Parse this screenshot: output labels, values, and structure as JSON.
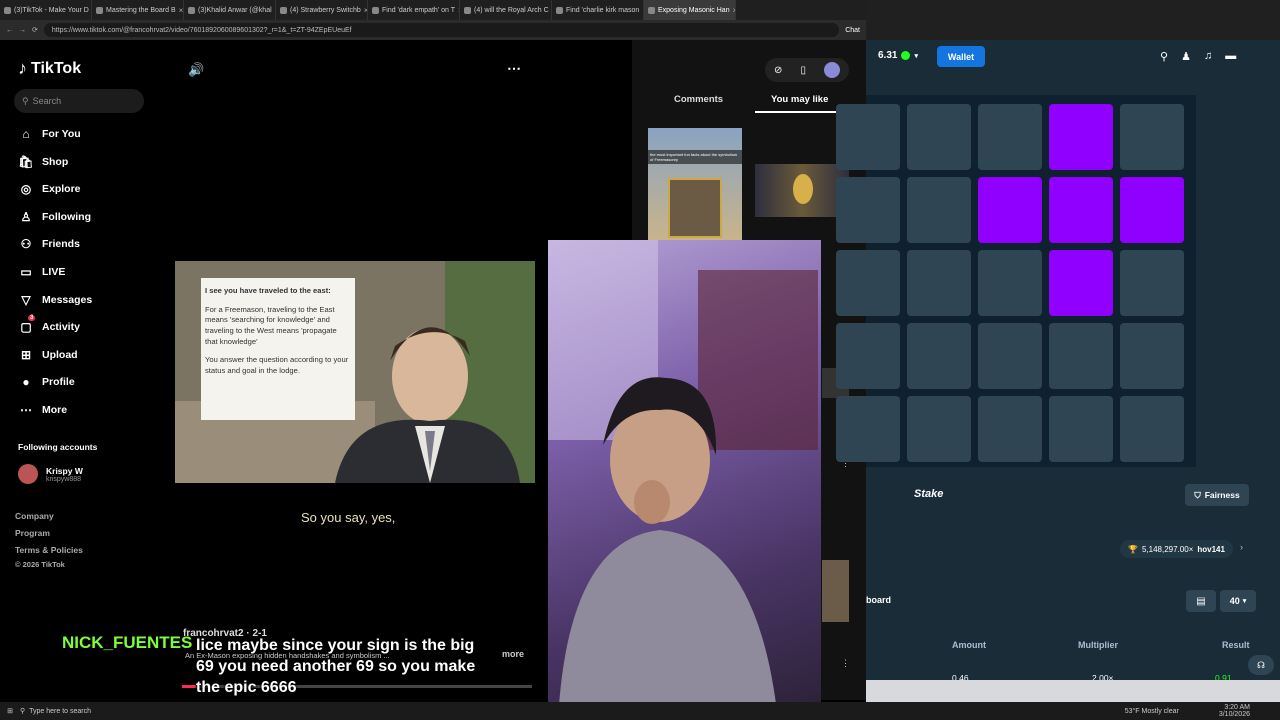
{
  "browser_left": {
    "tabs": [
      {
        "label": "(3)TikTok - Make Your D",
        "active": false
      },
      {
        "label": "Mastering the Board B",
        "active": false
      },
      {
        "label": "(3)Khalid Anwar (@khal",
        "active": false
      },
      {
        "label": "(4) Strawberry Switchb",
        "active": false
      },
      {
        "label": "Find 'dark empath' on T",
        "active": false
      },
      {
        "label": "(4) will the Royal Arch C",
        "active": false
      },
      {
        "label": "Find 'charlie kirk mason",
        "active": false
      },
      {
        "label": "Exposing Masonic Han",
        "active": true
      }
    ],
    "url": "https://www.tiktok.com/@francohrvat2/video/7601892060089601302?_r=1&_t=ZT-94ZEpEUeuEf",
    "chat_label": "Chat"
  },
  "tiktok": {
    "logo": "TikTok",
    "search_placeholder": "Search",
    "nav": [
      {
        "label": "For You",
        "icon": "home-icon",
        "glyph": "⌂"
      },
      {
        "label": "Shop",
        "icon": "shop-icon",
        "glyph": "🛍"
      },
      {
        "label": "Explore",
        "icon": "compass-icon",
        "glyph": "◎"
      },
      {
        "label": "Following",
        "icon": "following-icon",
        "glyph": "♙"
      },
      {
        "label": "Friends",
        "icon": "friends-icon",
        "glyph": "⚇"
      },
      {
        "label": "LIVE",
        "icon": "live-icon",
        "glyph": "▭"
      },
      {
        "label": "Messages",
        "icon": "messages-icon",
        "glyph": "▽"
      },
      {
        "label": "Activity",
        "icon": "activity-icon",
        "glyph": "▢",
        "badge": "3"
      },
      {
        "label": "Upload",
        "icon": "upload-icon",
        "glyph": "⊞"
      },
      {
        "label": "Profile",
        "icon": "profile-icon",
        "glyph": "●"
      },
      {
        "label": "More",
        "icon": "more-icon",
        "glyph": "⋯"
      }
    ],
    "following_title": "Following accounts",
    "following": [
      {
        "name": "Krispy W",
        "handle": "krispyw888"
      }
    ],
    "footer": [
      "Company",
      "Program",
      "Terms & Policies",
      "© 2026 TikTok"
    ],
    "video": {
      "card_heading": "I see you have traveled to the east:",
      "card_body1": "For a Freemason, traveling to the East means 'searching for knowledge' and traveling to the West means 'propagate that knowledge'",
      "card_body2": "You answer the question according to your status and goal in the lodge.",
      "caption": "So you say, yes,"
    },
    "author": "francohrvat2 · 2-1",
    "description": "An Ex-Mason exposing hidden handshakes and symbolism ...",
    "more": "more",
    "side_tabs": [
      "Comments",
      "You may like"
    ],
    "thumb_caption": "the most important fun facts about the symbolism of Freemasonry"
  },
  "stream_overlay": {
    "chat_name": "NICK_FUENTES",
    "chat_message": "lice maybe since your sign is the big 69 you need another 69 so you make the epic 6666"
  },
  "stake": {
    "balance": "6.31",
    "wallet": "Wallet",
    "brand": "Stake",
    "fairness": "Fairness",
    "bet_leader": "5,148,297.00×",
    "bet_user": "hov141",
    "leaderboard": "board",
    "bet_amount_select": "40",
    "columns": [
      "Amount",
      "Multiplier",
      "Result"
    ],
    "row": {
      "amount": "0.46",
      "multiplier": "2.00×",
      "result": "0.91"
    },
    "lit_cells": [
      [
        0,
        3
      ],
      [
        1,
        2
      ],
      [
        1,
        3
      ],
      [
        1,
        4
      ],
      [
        2,
        3
      ]
    ]
  },
  "taskbar": {
    "search": "Type here to search",
    "weather": "53°F  Mostly clear",
    "date": "3/10/2026",
    "time": "3:20 AM"
  },
  "colors": {
    "accent_stake": "#1475e1",
    "purple_tile": "#9000ff",
    "chat_green": "#7cff3a"
  }
}
